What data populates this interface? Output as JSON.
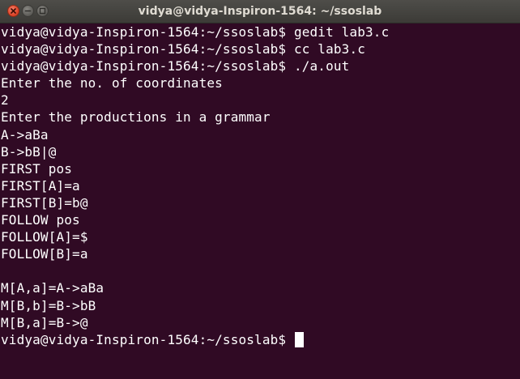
{
  "window": {
    "title": "vidya@vidya-Inspiron-1564: ~/ssoslab"
  },
  "terminal": {
    "lines": [
      "vidya@vidya-Inspiron-1564:~/ssoslab$ gedit lab3.c",
      "vidya@vidya-Inspiron-1564:~/ssoslab$ cc lab3.c",
      "vidya@vidya-Inspiron-1564:~/ssoslab$ ./a.out",
      "Enter the no. of coordinates",
      "2",
      "Enter the productions in a grammar",
      "A->aBa",
      "B->bB|@",
      "FIRST pos",
      "FIRST[A]=a",
      "FIRST[B]=b@",
      "FOLLOW pos",
      "FOLLOW[A]=$",
      "FOLLOW[B]=a",
      "",
      "M[A,a]=A->aBa",
      "M[B,b]=B->bB",
      "M[B,a]=B->@",
      "vidya@vidya-Inspiron-1564:~/ssoslab$ "
    ]
  }
}
